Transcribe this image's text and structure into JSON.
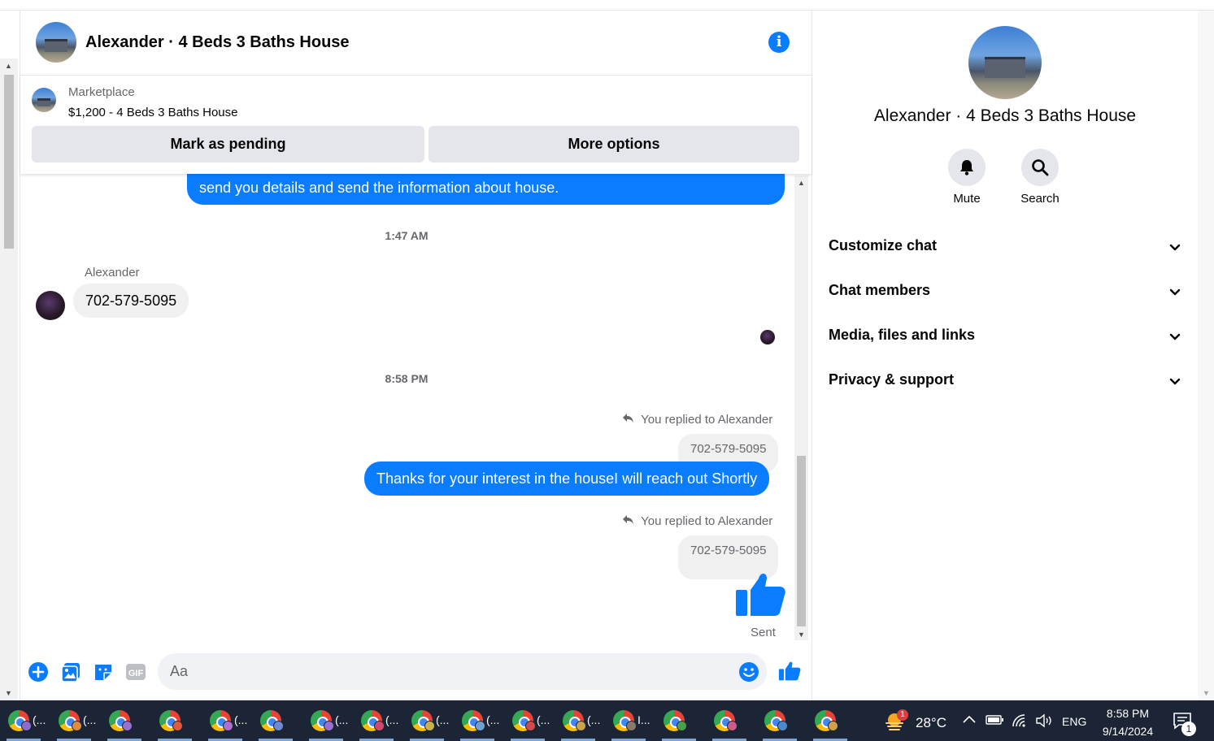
{
  "chat": {
    "title": "Alexander · 4 Beds 3 Baths House",
    "marketplace": {
      "label": "Marketplace",
      "item": "$1,200 - 4 Beds 3 Baths House",
      "pending_button": "Mark as pending",
      "more_button": "More options"
    },
    "messages": {
      "partial_out": "send you details and send the information about house.",
      "time1": "1:47 AM",
      "sender_name": "Alexander",
      "incoming_phone": "702-579-5095",
      "time2": "8:58 PM",
      "replied_label_1": "You replied to Alexander",
      "quoted_1": "702-579-5095",
      "outgoing_thanks": "Thanks for your interest in the houseI will reach out Shortly",
      "replied_label_2": "You replied to Alexander",
      "quoted_2": "702-579-5095",
      "status": "Sent"
    },
    "composer": {
      "placeholder": "Aa",
      "gif_label": "GIF"
    }
  },
  "info_panel": {
    "title": "Alexander · 4 Beds 3 Baths House",
    "actions": [
      {
        "label": "Mute",
        "icon": "bell-icon"
      },
      {
        "label": "Search",
        "icon": "search-icon"
      }
    ],
    "sections": [
      {
        "label": "Customize chat"
      },
      {
        "label": "Chat members"
      },
      {
        "label": "Media, files and links"
      },
      {
        "label": "Privacy & support"
      }
    ]
  },
  "taskbar": {
    "apps": [
      {
        "label": "(...",
        "profile_color": "#8e6cc9"
      },
      {
        "label": "(...",
        "profile_color": "#e08a3c"
      },
      {
        "label": "",
        "profile_color": "#9a6fd0"
      },
      {
        "label": "",
        "profile_color": "#e05a3c"
      },
      {
        "label": "(...",
        "profile_color": "#b06fd0"
      },
      {
        "label": "",
        "profile_color": "#6f8ad0"
      },
      {
        "label": "(...",
        "profile_color": "#9a6fd0"
      },
      {
        "label": "(...",
        "profile_color": "#d04a6f"
      },
      {
        "label": "(...",
        "profile_color": "#c9b24a"
      },
      {
        "label": "(...",
        "profile_color": "#6fa0d0"
      },
      {
        "label": "(...",
        "profile_color": "#d04a4a"
      },
      {
        "label": "(...",
        "profile_color": "#c9a24a"
      },
      {
        "label": "I...",
        "profile_color": "#8a7a6a"
      },
      {
        "label": "",
        "profile_color": "#4aa04a"
      },
      {
        "label": "",
        "profile_color": "#d05a8a"
      },
      {
        "label": "",
        "profile_color": "#4a8ad0"
      },
      {
        "label": "",
        "profile_color": "#d0a04a"
      }
    ],
    "weather_badge": "1",
    "temperature": "28°C",
    "language": "ENG",
    "time": "8:58 PM",
    "date": "9/14/2024",
    "notification_count": "1"
  },
  "colors": {
    "accent": "#0a7cff",
    "taskbar": "#1c2535"
  }
}
